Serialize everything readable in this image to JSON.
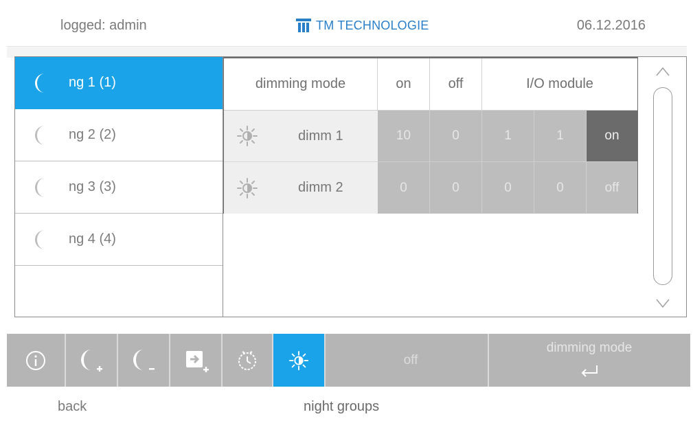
{
  "header": {
    "user": "logged: admin",
    "brand": "TM TECHNOLOGIE",
    "date": "06.12.2016"
  },
  "sidebar": {
    "items": [
      {
        "label": "ng 1 (1)",
        "icon": "moon-icon",
        "active": true
      },
      {
        "label": "ng 2 (2)",
        "icon": "moon-icon",
        "active": false
      },
      {
        "label": "ng 3 (3)",
        "icon": "moon-icon",
        "active": false
      },
      {
        "label": "ng 4 (4)",
        "icon": "moon-icon",
        "active": false
      }
    ]
  },
  "table": {
    "headers": {
      "mode": "dimming mode",
      "on": "on",
      "off": "off",
      "io": "I/O module"
    },
    "rows": [
      {
        "name": "dimm 1",
        "icon": "sun-icon",
        "on": "10",
        "off": "0",
        "io1": "1",
        "io2": "1",
        "state": "on"
      },
      {
        "name": "dimm 2",
        "icon": "sun-icon",
        "on": "0",
        "off": "0",
        "io1": "0",
        "io2": "0",
        "state": "off"
      }
    ]
  },
  "toolbar": {
    "state": "off",
    "mode_label": "dimming mode",
    "icons": [
      "info-icon",
      "moon-add-icon",
      "moon-remove-icon",
      "enter-add-icon",
      "clock-icon",
      "sun-icon",
      "enter-icon"
    ]
  },
  "footer": {
    "back": "back",
    "title": "night groups"
  },
  "colors": {
    "accent": "#1aa3e8",
    "brand": "#2a7fc9",
    "cell": "#bdbdbd",
    "cell_dark": "#6b6b6b",
    "toolbar": "#b5b5b5"
  }
}
